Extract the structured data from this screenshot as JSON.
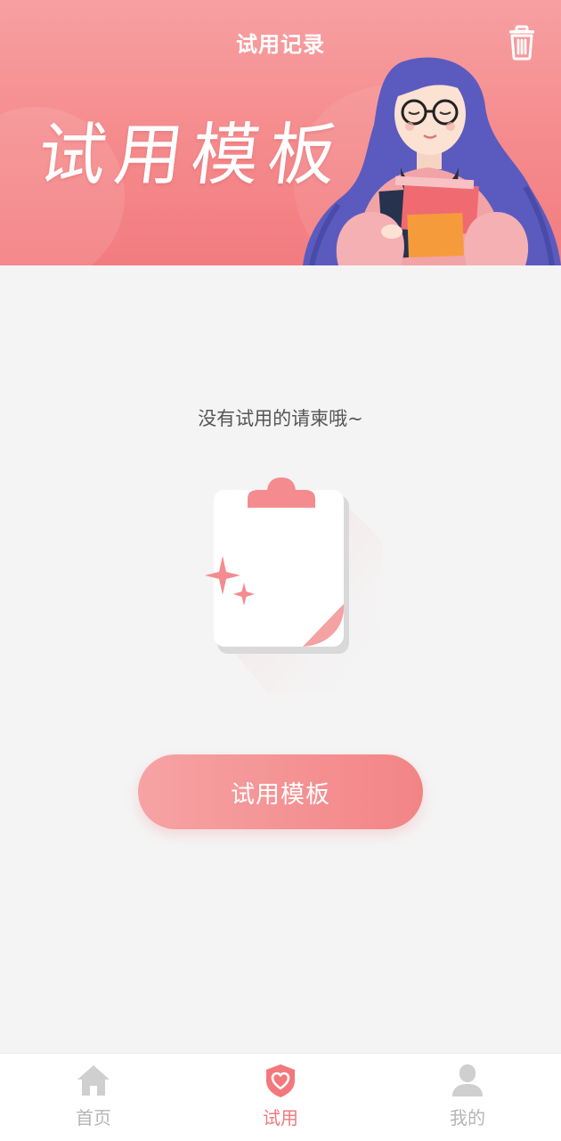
{
  "header": {
    "title": "试用记录",
    "banner_title": "试用模板",
    "trash_icon": "trash-icon"
  },
  "main": {
    "empty_message": "没有试用的请柬哦~",
    "action_button": "试用模板",
    "illustration_icon": "clipboard-sparkle-icon"
  },
  "tabbar": {
    "items": [
      {
        "label": "首页",
        "icon": "home-icon",
        "active": false
      },
      {
        "label": "试用",
        "icon": "heart-shield-icon",
        "active": true
      },
      {
        "label": "我的",
        "icon": "user-icon",
        "active": false
      }
    ]
  },
  "colors": {
    "accent": "#f2787c",
    "banner": "#f58a8c",
    "inactive": "#b5b5b5",
    "background": "#f4f4f4"
  }
}
